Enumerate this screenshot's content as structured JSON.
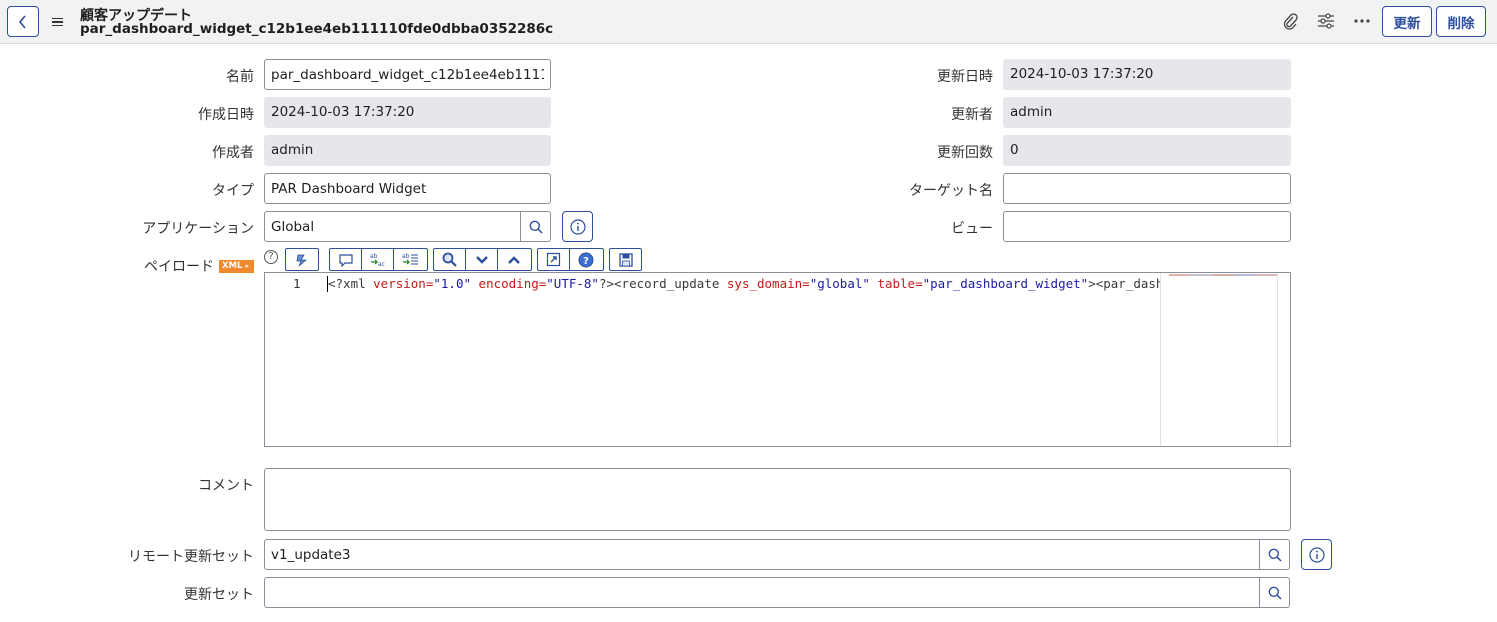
{
  "header": {
    "title": "顧客アップデート",
    "record_name": "par_dashboard_widget_c12b1ee4eb111110fde0dbba0352286c",
    "update_button": "更新",
    "delete_button": "削除"
  },
  "form": {
    "name": {
      "label": "名前",
      "value": "par_dashboard_widget_c12b1ee4eb111110fde0dbba0352286c"
    },
    "created": {
      "label": "作成日時",
      "value": "2024-10-03 17:37:20"
    },
    "created_by": {
      "label": "作成者",
      "value": "admin"
    },
    "type": {
      "label": "タイプ",
      "value": "PAR Dashboard Widget"
    },
    "application": {
      "label": "アプリケーション",
      "value": "Global"
    },
    "updated": {
      "label": "更新日時",
      "value": "2024-10-03 17:37:20"
    },
    "updated_by": {
      "label": "更新者",
      "value": "admin"
    },
    "update_count": {
      "label": "更新回数",
      "value": "0"
    },
    "target_name": {
      "label": "ターゲット名",
      "value": ""
    },
    "view": {
      "label": "ビュー",
      "value": ""
    },
    "payload": {
      "label": "ペイロード",
      "badge": "XML",
      "help": "?",
      "line_number": "1",
      "code": [
        {
          "k": "tag",
          "t": "<?xml "
        },
        {
          "k": "attr",
          "t": "version="
        },
        {
          "k": "val",
          "t": "\"1.0\""
        },
        {
          "k": "tag",
          "t": " "
        },
        {
          "k": "attr",
          "t": "encoding="
        },
        {
          "k": "val",
          "t": "\"UTF-8\""
        },
        {
          "k": "tag",
          "t": "?><record_update "
        },
        {
          "k": "attr",
          "t": "sys_domain="
        },
        {
          "k": "val",
          "t": "\"global\""
        },
        {
          "k": "tag",
          "t": " "
        },
        {
          "k": "attr",
          "t": "table="
        },
        {
          "k": "val",
          "t": "\"par_dashboard_widget\""
        },
        {
          "k": "tag",
          "t": "><par_dashboard_widget"
        }
      ]
    },
    "comment": {
      "label": "コメント",
      "value": ""
    },
    "remote_update_set": {
      "label": "リモート更新セット",
      "value": "v1_update3"
    },
    "update_set": {
      "label": "更新セット",
      "value": ""
    }
  },
  "icons": {
    "header": [
      "chevron-left-icon",
      "hamburger-icon",
      "paperclip-icon",
      "sliders-icon",
      "more-icon"
    ],
    "toolbar": [
      "format-icon",
      "comment-icon",
      "replace-icon",
      "replace-all-icon",
      "search-icon",
      "chevron-down-icon",
      "chevron-up-icon",
      "fullscreen-icon",
      "help-icon",
      "save-icon"
    ]
  },
  "colors": {
    "accent": "#2d4f9e",
    "readonly_bg": "#e6e7ea",
    "header_bg": "#f1f2f4",
    "xml_badge": "#f0892c"
  }
}
